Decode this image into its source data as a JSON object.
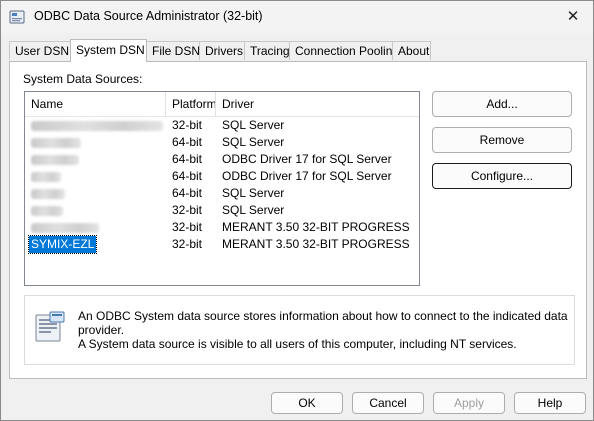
{
  "window": {
    "title": "ODBC Data Source Administrator (32-bit)",
    "close_glyph": "✕"
  },
  "tabs": [
    {
      "label": "User DSN",
      "active": false
    },
    {
      "label": "System DSN",
      "active": true
    },
    {
      "label": "File DSN",
      "active": false
    },
    {
      "label": "Drivers",
      "active": false
    },
    {
      "label": "Tracing",
      "active": false
    },
    {
      "label": "Connection Pooling",
      "active": false
    },
    {
      "label": "About",
      "active": false
    }
  ],
  "panel": {
    "section_label": "System Data Sources:",
    "columns": [
      "Name",
      "Platform",
      "Driver"
    ],
    "rows": [
      {
        "name": "",
        "platform": "32-bit",
        "driver": "SQL Server"
      },
      {
        "name": "",
        "platform": "64-bit",
        "driver": "SQL Server"
      },
      {
        "name": "",
        "platform": "64-bit",
        "driver": "ODBC Driver 17 for SQL Server"
      },
      {
        "name": "",
        "platform": "64-bit",
        "driver": "ODBC Driver 17 for SQL Server"
      },
      {
        "name": "",
        "platform": "64-bit",
        "driver": "SQL Server"
      },
      {
        "name": "",
        "platform": "32-bit",
        "driver": "SQL Server"
      },
      {
        "name": "",
        "platform": "32-bit",
        "driver": "MERANT 3.50 32-BIT PROGRESS"
      },
      {
        "name": "SYMIX-EZL",
        "platform": "32-bit",
        "driver": "MERANT 3.50 32-BIT PROGRESS",
        "selected": true
      }
    ],
    "buttons": {
      "add": "Add...",
      "remove": "Remove",
      "configure": "Configure..."
    },
    "info_text_line1": "An ODBC System data source stores information about how to connect to the indicated data provider.",
    "info_text_line2": "A System data source is visible to all users of this computer, including NT services."
  },
  "footer": {
    "ok": "OK",
    "cancel": "Cancel",
    "apply": "Apply",
    "help": "Help"
  },
  "colors": {
    "selection": "#0078d7",
    "window_bg": "#f0f0f0"
  }
}
